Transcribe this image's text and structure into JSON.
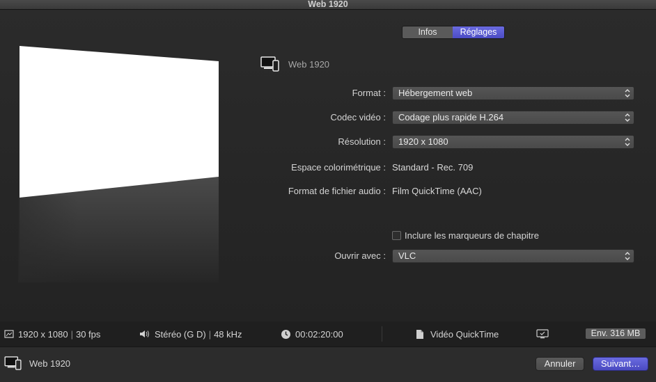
{
  "window": {
    "title": "Web 1920"
  },
  "tabs": [
    {
      "label": "Infos",
      "selected": false
    },
    {
      "label": "Réglages",
      "selected": true
    }
  ],
  "destination": {
    "name": "Web 1920",
    "icon": "computer-devices-icon"
  },
  "settings": {
    "format": {
      "label": "Format :",
      "value": "Hébergement web"
    },
    "codec": {
      "label": "Codec vidéo :",
      "value": "Codage plus rapide H.264"
    },
    "resolution": {
      "label": "Résolution :",
      "value": "1920 x 1080"
    },
    "colorspace": {
      "label": "Espace colorimétrique :",
      "value": "Standard - Rec. 709"
    },
    "audio_format": {
      "label": "Format de fichier audio :",
      "value": "Film QuickTime (AAC)"
    },
    "chapter_markers": {
      "label": "Inclure les marqueurs de chapitre",
      "checked": false
    },
    "open_with": {
      "label": "Ouvrir avec :",
      "value": "VLC"
    }
  },
  "status": {
    "video": {
      "resolution": "1920 x 1080",
      "fps": "30 fps"
    },
    "audio": {
      "channels": "Stéréo (G D)",
      "rate": "48 kHz"
    },
    "duration": "00:02:20:00",
    "file_type": "Vidéo QuickTime",
    "size": "Env. 316 MB"
  },
  "buttons": {
    "cancel": "Annuler",
    "next": "Suivant…"
  },
  "colors": {
    "accent": "#5858d4",
    "background": "#232323"
  }
}
